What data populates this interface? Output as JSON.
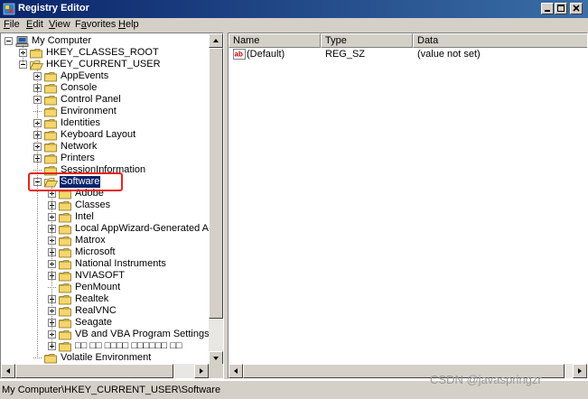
{
  "window": {
    "title": "Registry Editor"
  },
  "menu": [
    {
      "label": "File",
      "key": "F",
      "rest": "ile"
    },
    {
      "label": "Edit",
      "key": "E",
      "rest": "dit"
    },
    {
      "label": "View",
      "key": "V",
      "rest": "iew"
    },
    {
      "label": "Favorites",
      "key": "a",
      "pre": "F",
      "rest": "vorites"
    },
    {
      "label": "Help",
      "key": "H",
      "rest": "elp"
    }
  ],
  "tree": [
    {
      "label": "My Computer",
      "level": 0,
      "expander": "minus",
      "icon": "computer-icon"
    },
    {
      "label": "HKEY_CLASSES_ROOT",
      "level": 1,
      "expander": "plus",
      "icon": "folder-icon"
    },
    {
      "label": "HKEY_CURRENT_USER",
      "level": 1,
      "expander": "minus",
      "icon": "folder-open-icon"
    },
    {
      "label": "AppEvents",
      "level": 2,
      "expander": "plus",
      "icon": "folder-icon"
    },
    {
      "label": "Console",
      "level": 2,
      "expander": "plus",
      "icon": "folder-icon"
    },
    {
      "label": "Control Panel",
      "level": 2,
      "expander": "plus",
      "icon": "folder-icon"
    },
    {
      "label": "Environment",
      "level": 2,
      "expander": "none",
      "icon": "folder-icon"
    },
    {
      "label": "Identities",
      "level": 2,
      "expander": "plus",
      "icon": "folder-icon"
    },
    {
      "label": "Keyboard Layout",
      "level": 2,
      "expander": "plus",
      "icon": "folder-icon"
    },
    {
      "label": "Network",
      "level": 2,
      "expander": "plus",
      "icon": "folder-icon"
    },
    {
      "label": "Printers",
      "level": 2,
      "expander": "plus",
      "icon": "folder-icon"
    },
    {
      "label": "SessionInformation",
      "level": 2,
      "expander": "none",
      "icon": "folder-icon"
    },
    {
      "label": "Software",
      "level": 2,
      "expander": "minus",
      "icon": "folder-open-icon",
      "selected": true
    },
    {
      "label": "Adobe",
      "level": 3,
      "expander": "plus",
      "icon": "folder-icon"
    },
    {
      "label": "Classes",
      "level": 3,
      "expander": "plus",
      "icon": "folder-icon"
    },
    {
      "label": "Intel",
      "level": 3,
      "expander": "plus",
      "icon": "folder-icon"
    },
    {
      "label": "Local AppWizard-Generated Applicat",
      "level": 3,
      "expander": "plus",
      "icon": "folder-icon"
    },
    {
      "label": "Matrox",
      "level": 3,
      "expander": "plus",
      "icon": "folder-icon"
    },
    {
      "label": "Microsoft",
      "level": 3,
      "expander": "plus",
      "icon": "folder-icon"
    },
    {
      "label": "National Instruments",
      "level": 3,
      "expander": "plus",
      "icon": "folder-icon"
    },
    {
      "label": "NVIASOFT",
      "level": 3,
      "expander": "plus",
      "icon": "folder-icon"
    },
    {
      "label": "PenMount",
      "level": 3,
      "expander": "none",
      "icon": "folder-icon"
    },
    {
      "label": "Realtek",
      "level": 3,
      "expander": "plus",
      "icon": "folder-icon"
    },
    {
      "label": "RealVNC",
      "level": 3,
      "expander": "plus",
      "icon": "folder-icon"
    },
    {
      "label": "Seagate",
      "level": 3,
      "expander": "plus",
      "icon": "folder-icon"
    },
    {
      "label": "VB and VBA Program Settings",
      "level": 3,
      "expander": "plus",
      "icon": "folder-icon"
    },
    {
      "label": "□□ □□ □□□□ □□□□□□ □□",
      "level": 3,
      "expander": "plus",
      "icon": "folder-icon"
    },
    {
      "label": "Volatile Environment",
      "level": 2,
      "expander": "none",
      "icon": "folder-icon"
    }
  ],
  "list": {
    "columns": [
      "Name",
      "Type",
      "Data"
    ],
    "rows": [
      {
        "name": "(Default)",
        "type": "REG_SZ",
        "data": "(value not set)",
        "icon": "string-value-icon"
      }
    ]
  },
  "status": {
    "path": "My Computer\\HKEY_CURRENT_USER\\Software"
  },
  "watermark": "CSDN @javaspringzr",
  "colors": {
    "titlebar": "#0a246a",
    "selection": "#0a246a",
    "highlight_box": "#e8231e",
    "face": "#d4d0c8"
  }
}
